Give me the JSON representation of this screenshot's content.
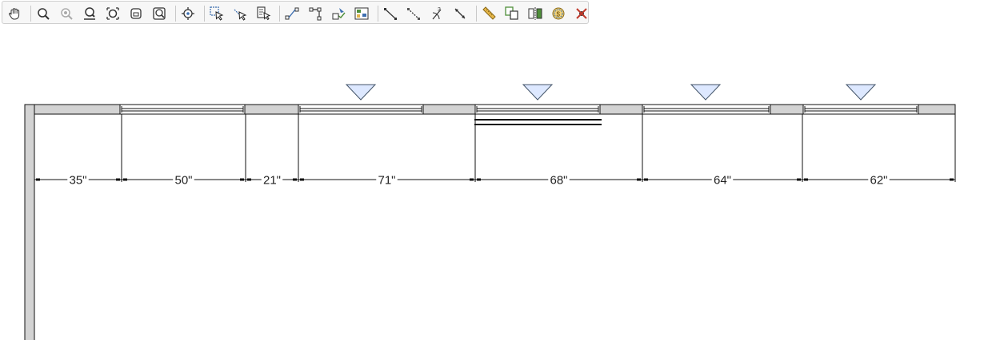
{
  "toolbar": {
    "groups": [
      [
        "pan-icon"
      ],
      [
        "zoom-in-icon",
        "zoom-disabled-icon",
        "zoom-out-icon",
        "fill-window-icon",
        "zoom-window-icon",
        "zoom-extents-icon"
      ],
      [
        "center-view-icon"
      ],
      [
        "select-objects-icon",
        "select-sub-objects-icon",
        "edit-selected-icon"
      ],
      [
        "connect-points-icon",
        "edit-handles-icon",
        "edit-area-icon",
        "group-select-icon"
      ],
      [
        "dimension-line-icon",
        "temporary-dimension-icon",
        "angle-dimension-icon",
        "resize-dimension-icon"
      ],
      [
        "measure-tape-icon",
        "copy-paste-icon",
        "reflect-about-icon",
        "material-cost-icon",
        "delete-objects-icon"
      ]
    ]
  },
  "drawing": {
    "dimensions": [
      "35\"",
      "50\"",
      "21\"",
      "71\"",
      "68\"",
      "64\"",
      "62\""
    ],
    "colors": {
      "wall_fill": "#d3d3d3",
      "line": "#111111",
      "marker_fill": "#dde8ff",
      "marker_stroke": "#44556a",
      "toolbar_accent": "#3d6fb0",
      "toolbar_green": "#4f8f3a",
      "delete_red": "#c0392b"
    }
  }
}
